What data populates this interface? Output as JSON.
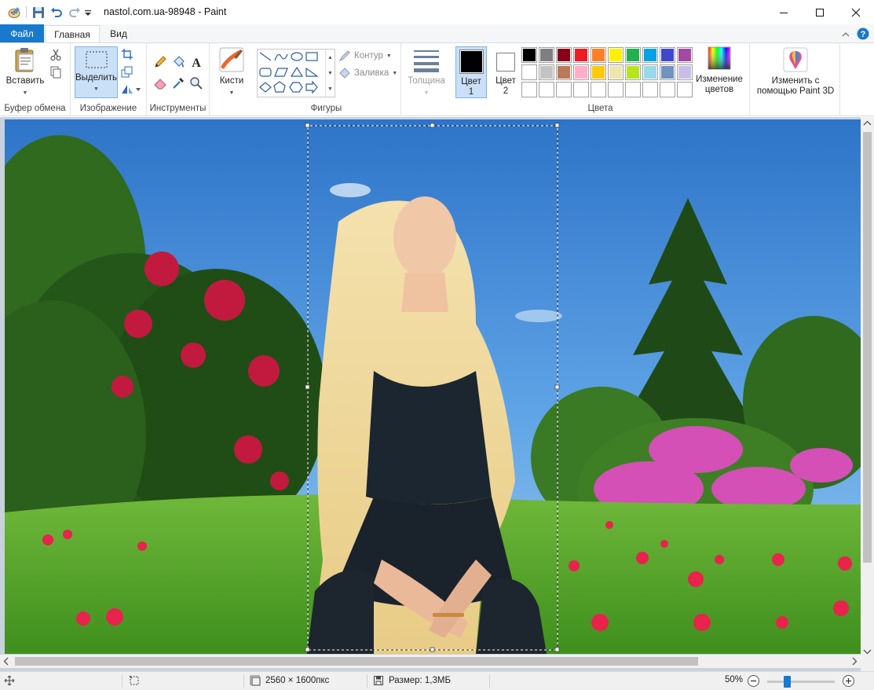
{
  "window": {
    "title": "nastol.com.ua-98948 - Paint"
  },
  "tabs": [
    {
      "label": "Файл"
    },
    {
      "label": "Главная"
    },
    {
      "label": "Вид"
    }
  ],
  "ribbon": {
    "clipboard": {
      "paste_label": "Вставить",
      "group_label": "Буфер обмена"
    },
    "image": {
      "select_label": "Выделить",
      "group_label": "Изображение"
    },
    "tools": {
      "group_label": "Инструменты"
    },
    "brushes": {
      "label": "Кисти"
    },
    "shapes": {
      "outline_label": "Контур",
      "fill_label": "Заливка",
      "group_label": "Фигуры"
    },
    "size": {
      "label": "Толщина"
    },
    "colors": {
      "color1_label": "Цвет",
      "color1_num": "1",
      "color2_label": "Цвет",
      "color2_num": "2",
      "edit_colors_line1": "Изменение",
      "edit_colors_line2": "цветов",
      "group_label": "Цвета",
      "color1": "#000000",
      "color2": "#ffffff",
      "palette_row1": [
        "#000000",
        "#7f7f7f",
        "#880015",
        "#ed1c24",
        "#ff7f27",
        "#fff200",
        "#22b14c",
        "#00a2e8",
        "#3f48cc",
        "#a349a4"
      ],
      "palette_row2": [
        "#ffffff",
        "#c3c3c3",
        "#b97a57",
        "#ffaec9",
        "#ffc90e",
        "#efe4b0",
        "#b5e61d",
        "#99d9ea",
        "#7092be",
        "#c8bfe7"
      ],
      "palette_row3": [
        "",
        "",
        "",
        "",
        "",
        "",
        "",
        "",
        "",
        ""
      ]
    },
    "paint3d": {
      "line1": "Изменить с",
      "line2": "помощью Paint 3D"
    }
  },
  "status": {
    "dimensions": "2560 × 1600пкс",
    "size": "Размер: 1,3МБ",
    "zoom": "50%",
    "zoom_level": 0.5
  }
}
